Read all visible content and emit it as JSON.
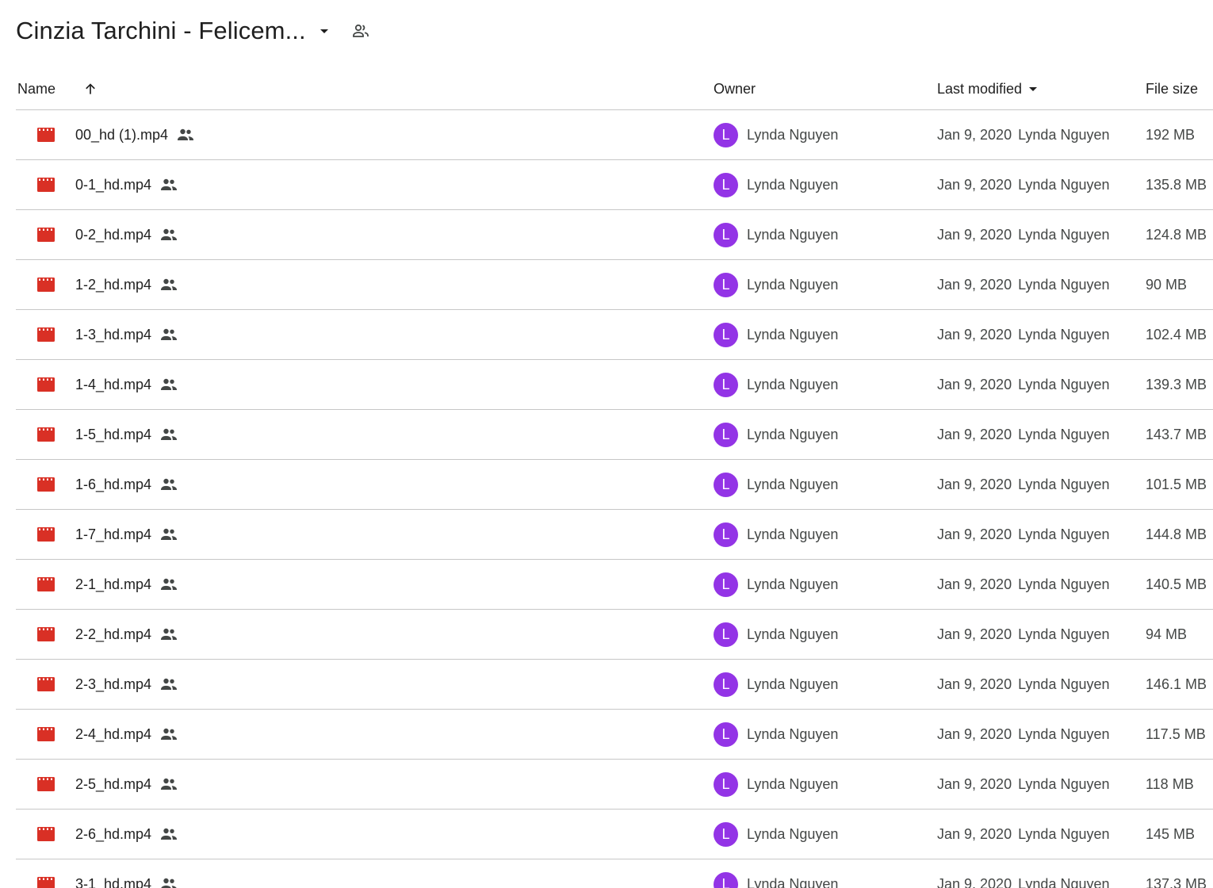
{
  "folder": {
    "title": "Cinzia Tarchini - Felicem...",
    "caret_icon": "arrow-drop-down-icon",
    "shared_icon": "people-outline-icon"
  },
  "columns": {
    "name": "Name",
    "owner": "Owner",
    "last_modified": "Last modified",
    "file_size": "File size",
    "sort_icon": "arrow-upward-icon",
    "modified_sort_icon": "arrow-drop-down-icon"
  },
  "colors": {
    "video_icon": "#d93025",
    "avatar": "#9334e6",
    "divider": "#c7c7c7",
    "secondary_text": "#444746"
  },
  "files": [
    {
      "name": "00_hd (1).mp4",
      "owner_initial": "L",
      "owner": "Lynda Nguyen",
      "date": "Jan 9, 2020",
      "modified_by": "Lynda Nguyen",
      "size": "192 MB"
    },
    {
      "name": "0-1_hd.mp4",
      "owner_initial": "L",
      "owner": "Lynda Nguyen",
      "date": "Jan 9, 2020",
      "modified_by": "Lynda Nguyen",
      "size": "135.8 MB"
    },
    {
      "name": "0-2_hd.mp4",
      "owner_initial": "L",
      "owner": "Lynda Nguyen",
      "date": "Jan 9, 2020",
      "modified_by": "Lynda Nguyen",
      "size": "124.8 MB"
    },
    {
      "name": "1-2_hd.mp4",
      "owner_initial": "L",
      "owner": "Lynda Nguyen",
      "date": "Jan 9, 2020",
      "modified_by": "Lynda Nguyen",
      "size": "90 MB"
    },
    {
      "name": "1-3_hd.mp4",
      "owner_initial": "L",
      "owner": "Lynda Nguyen",
      "date": "Jan 9, 2020",
      "modified_by": "Lynda Nguyen",
      "size": "102.4 MB"
    },
    {
      "name": "1-4_hd.mp4",
      "owner_initial": "L",
      "owner": "Lynda Nguyen",
      "date": "Jan 9, 2020",
      "modified_by": "Lynda Nguyen",
      "size": "139.3 MB"
    },
    {
      "name": "1-5_hd.mp4",
      "owner_initial": "L",
      "owner": "Lynda Nguyen",
      "date": "Jan 9, 2020",
      "modified_by": "Lynda Nguyen",
      "size": "143.7 MB"
    },
    {
      "name": "1-6_hd.mp4",
      "owner_initial": "L",
      "owner": "Lynda Nguyen",
      "date": "Jan 9, 2020",
      "modified_by": "Lynda Nguyen",
      "size": "101.5 MB"
    },
    {
      "name": "1-7_hd.mp4",
      "owner_initial": "L",
      "owner": "Lynda Nguyen",
      "date": "Jan 9, 2020",
      "modified_by": "Lynda Nguyen",
      "size": "144.8 MB"
    },
    {
      "name": "2-1_hd.mp4",
      "owner_initial": "L",
      "owner": "Lynda Nguyen",
      "date": "Jan 9, 2020",
      "modified_by": "Lynda Nguyen",
      "size": "140.5 MB"
    },
    {
      "name": "2-2_hd.mp4",
      "owner_initial": "L",
      "owner": "Lynda Nguyen",
      "date": "Jan 9, 2020",
      "modified_by": "Lynda Nguyen",
      "size": "94 MB"
    },
    {
      "name": "2-3_hd.mp4",
      "owner_initial": "L",
      "owner": "Lynda Nguyen",
      "date": "Jan 9, 2020",
      "modified_by": "Lynda Nguyen",
      "size": "146.1 MB"
    },
    {
      "name": "2-4_hd.mp4",
      "owner_initial": "L",
      "owner": "Lynda Nguyen",
      "date": "Jan 9, 2020",
      "modified_by": "Lynda Nguyen",
      "size": "117.5 MB"
    },
    {
      "name": "2-5_hd.mp4",
      "owner_initial": "L",
      "owner": "Lynda Nguyen",
      "date": "Jan 9, 2020",
      "modified_by": "Lynda Nguyen",
      "size": "118 MB"
    },
    {
      "name": "2-6_hd.mp4",
      "owner_initial": "L",
      "owner": "Lynda Nguyen",
      "date": "Jan 9, 2020",
      "modified_by": "Lynda Nguyen",
      "size": "145 MB"
    },
    {
      "name": "3-1_hd.mp4",
      "owner_initial": "L",
      "owner": "Lynda Nguyen",
      "date": "Jan 9, 2020",
      "modified_by": "Lynda Nguyen",
      "size": "137.3 MB"
    }
  ]
}
